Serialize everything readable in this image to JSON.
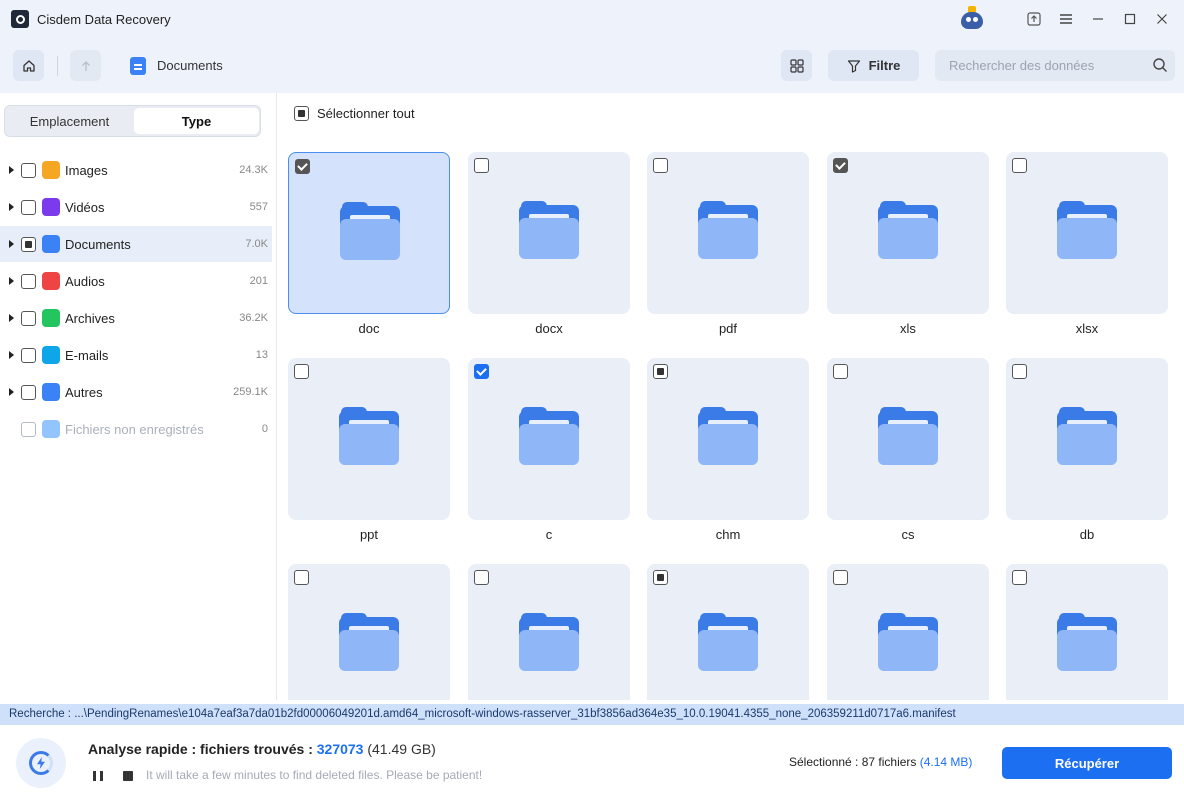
{
  "app": {
    "title": "Cisdem Data Recovery"
  },
  "window_controls": [
    "upload-icon",
    "menu-icon",
    "minimize-icon",
    "maximize-icon",
    "close-icon"
  ],
  "toolbar": {
    "path_label": "Documents",
    "filter_label": "Filtre",
    "search_placeholder": "Rechercher des données"
  },
  "sidebar": {
    "tabs": {
      "location": "Emplacement",
      "type": "Type",
      "active": "Type"
    },
    "categories": [
      {
        "label": "Images",
        "count": "24.3K",
        "color": "#f5a623",
        "icon": "image-icon",
        "expandable": true,
        "state": "unchecked"
      },
      {
        "label": "Vidéos",
        "count": "557",
        "color": "#7c3aed",
        "icon": "video-icon",
        "expandable": true,
        "state": "unchecked"
      },
      {
        "label": "Documents",
        "count": "7.0K",
        "color": "#3b82f6",
        "icon": "document-icon",
        "expandable": true,
        "state": "partial",
        "active": true
      },
      {
        "label": "Audios",
        "count": "201",
        "color": "#ef4444",
        "icon": "music-icon",
        "expandable": true,
        "state": "unchecked"
      },
      {
        "label": "Archives",
        "count": "36.2K",
        "color": "#22c55e",
        "icon": "archive-icon",
        "expandable": true,
        "state": "unchecked"
      },
      {
        "label": "E-mails",
        "count": "13",
        "color": "#0ea5e9",
        "icon": "email-icon",
        "expandable": true,
        "state": "unchecked"
      },
      {
        "label": "Autres",
        "count": "259.1K",
        "color": "#3b82f6",
        "icon": "other-files-icon",
        "expandable": true,
        "state": "unchecked"
      },
      {
        "label": "Fichiers non enregistrés",
        "count": "0",
        "color": "#93c5fd",
        "icon": "unsaved-files-icon",
        "expandable": false,
        "state": "disabled"
      }
    ]
  },
  "main": {
    "select_all_label": "Sélectionner tout",
    "select_all_state": "partial",
    "folders": [
      {
        "label": "doc",
        "state": "checked",
        "selected": true
      },
      {
        "label": "docx",
        "state": "unchecked"
      },
      {
        "label": "pdf",
        "state": "unchecked"
      },
      {
        "label": "xls",
        "state": "checked"
      },
      {
        "label": "xlsx",
        "state": "unchecked"
      },
      {
        "label": "ppt",
        "state": "unchecked"
      },
      {
        "label": "c",
        "state": "checked-blue"
      },
      {
        "label": "chm",
        "state": "partial"
      },
      {
        "label": "cs",
        "state": "unchecked"
      },
      {
        "label": "db",
        "state": "unchecked"
      },
      {
        "label": "",
        "state": "unchecked"
      },
      {
        "label": "",
        "state": "unchecked"
      },
      {
        "label": "",
        "state": "partial"
      },
      {
        "label": "",
        "state": "unchecked"
      },
      {
        "label": "",
        "state": "unchecked"
      }
    ]
  },
  "status": {
    "search_path": "Recherche : ...\\PendingRenames\\e104a7eaf3a7da01b2fd00006049201d.amd64_microsoft-windows-rasserver_31bf3856ad364e35_10.0.19041.4355_none_206359211d0717a6.manifest",
    "scan_title": "Analyse rapide : fichiers trouvés : ",
    "found_count": "327073",
    "found_size": " (41.49 GB)",
    "hint": "It will take a few minutes to find deleted files. Please be patient!",
    "selected_prefix": "Sélectionné : 87 fichiers ",
    "selected_size": "(4.14 MB)",
    "recover_label": "Récupérer"
  }
}
